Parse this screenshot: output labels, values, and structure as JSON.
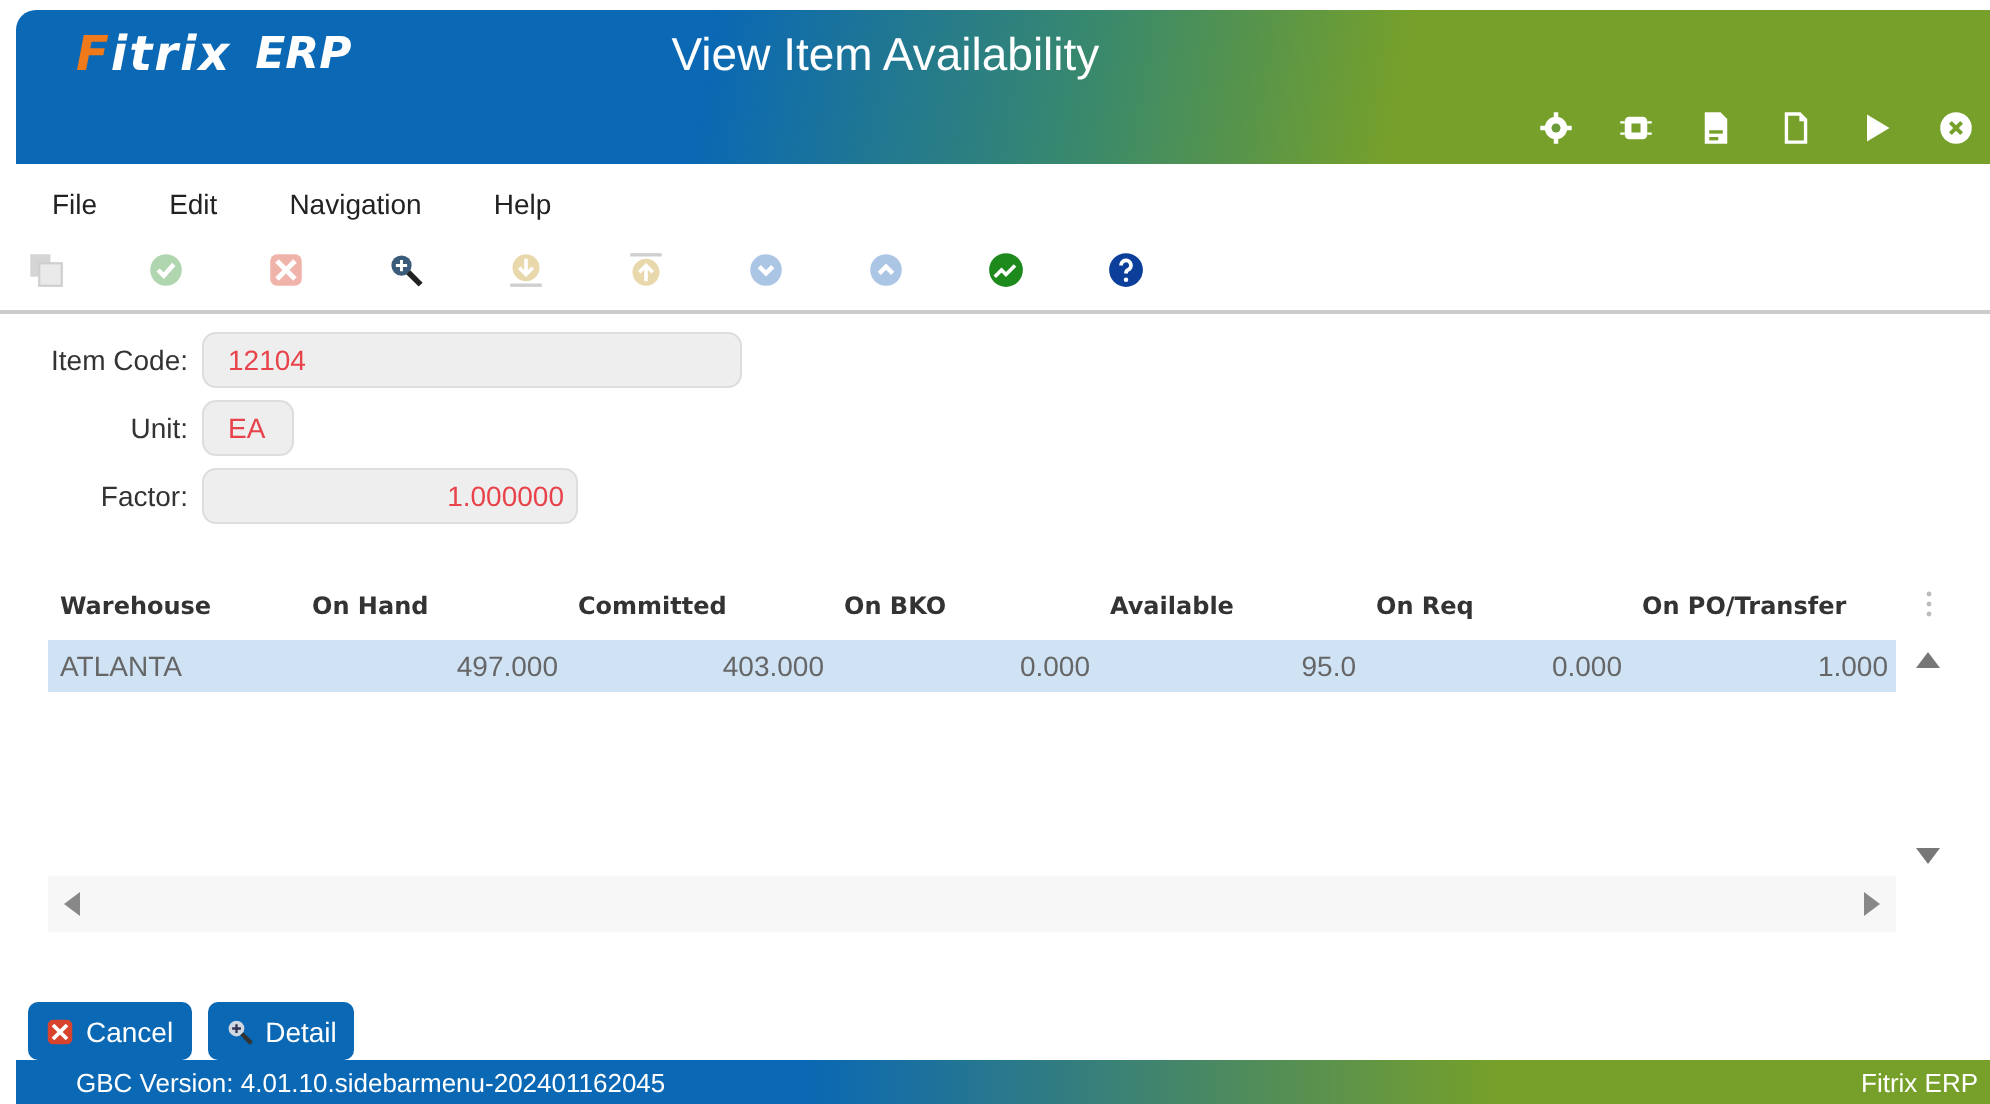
{
  "header": {
    "logo": "Fitrix",
    "logo_suffix": "ERP",
    "title": "View Item Availability",
    "actions": [
      {
        "kind": "gear"
      },
      {
        "kind": "chip"
      },
      {
        "kind": "doc"
      },
      {
        "kind": "page"
      },
      {
        "kind": "play"
      },
      {
        "kind": "close"
      }
    ]
  },
  "menu": [
    "File",
    "Edit",
    "Navigation",
    "Help"
  ],
  "toolbar": [
    {
      "kind": "copy",
      "disabled": true
    },
    {
      "kind": "accept",
      "disabled": true
    },
    {
      "kind": "cancel",
      "disabled": true
    },
    {
      "kind": "zoom",
      "disabled": false
    },
    {
      "kind": "down-arrow",
      "disabled": true
    },
    {
      "kind": "up-arrow",
      "disabled": true
    },
    {
      "kind": "next",
      "disabled": true
    },
    {
      "kind": "prev",
      "disabled": true
    },
    {
      "kind": "chart",
      "disabled": false
    },
    {
      "kind": "help",
      "disabled": false
    }
  ],
  "form": {
    "item_code": {
      "label": "Item Code:",
      "value": "12104"
    },
    "unit": {
      "label": "Unit:",
      "value": "EA"
    },
    "factor": {
      "label": "Factor:",
      "value": "1.000000"
    }
  },
  "table": {
    "columns": [
      "Warehouse",
      "On Hand",
      "Committed",
      "On BKO",
      "Available",
      "On Req",
      "On PO/Transfer"
    ],
    "rows": [
      {
        "cells": [
          "ATLANTA",
          "497.000",
          "403.000",
          "0.000",
          "95.0",
          "0.000",
          "1.000"
        ],
        "selected": true
      }
    ]
  },
  "buttons": [
    {
      "kind": "cancel",
      "label": "Cancel"
    },
    {
      "kind": "detail",
      "label": "Detail"
    }
  ],
  "status_bar": {
    "version": "GBC Version: 4.01.10.sidebarmenu-202401162045",
    "app": "Fitrix ERP"
  }
}
